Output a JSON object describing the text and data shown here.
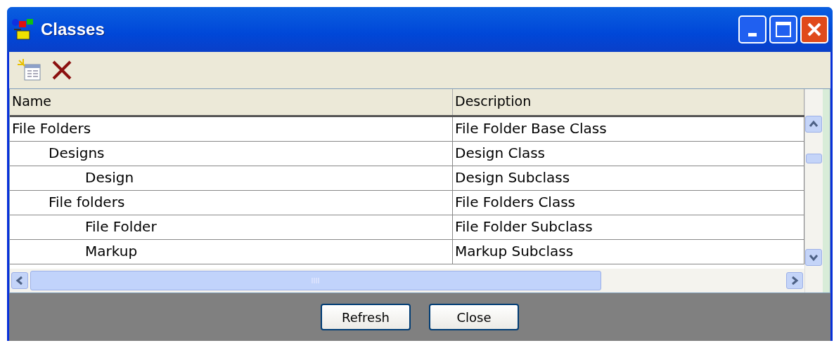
{
  "window": {
    "title": "Classes"
  },
  "toolbar": [
    {
      "kind": "new"
    },
    {
      "kind": "delete"
    }
  ],
  "table": {
    "columns": [
      "Name",
      "Description"
    ],
    "rows": [
      {
        "name": "File Folders",
        "description": "File Folder Base Class",
        "children": [
          {
            "name": "Designs",
            "description": "Design Class",
            "children": [
              {
                "name": "Design",
                "description": "Design Subclass"
              }
            ]
          },
          {
            "name": "File folders",
            "description": "File Folders Class",
            "children": [
              {
                "name": "File Folder",
                "description": "File Folder Subclass"
              },
              {
                "name": "Markup",
                "description": "Markup Subclass"
              }
            ]
          }
        ]
      }
    ]
  },
  "buttons": [
    "Refresh",
    "Close"
  ]
}
